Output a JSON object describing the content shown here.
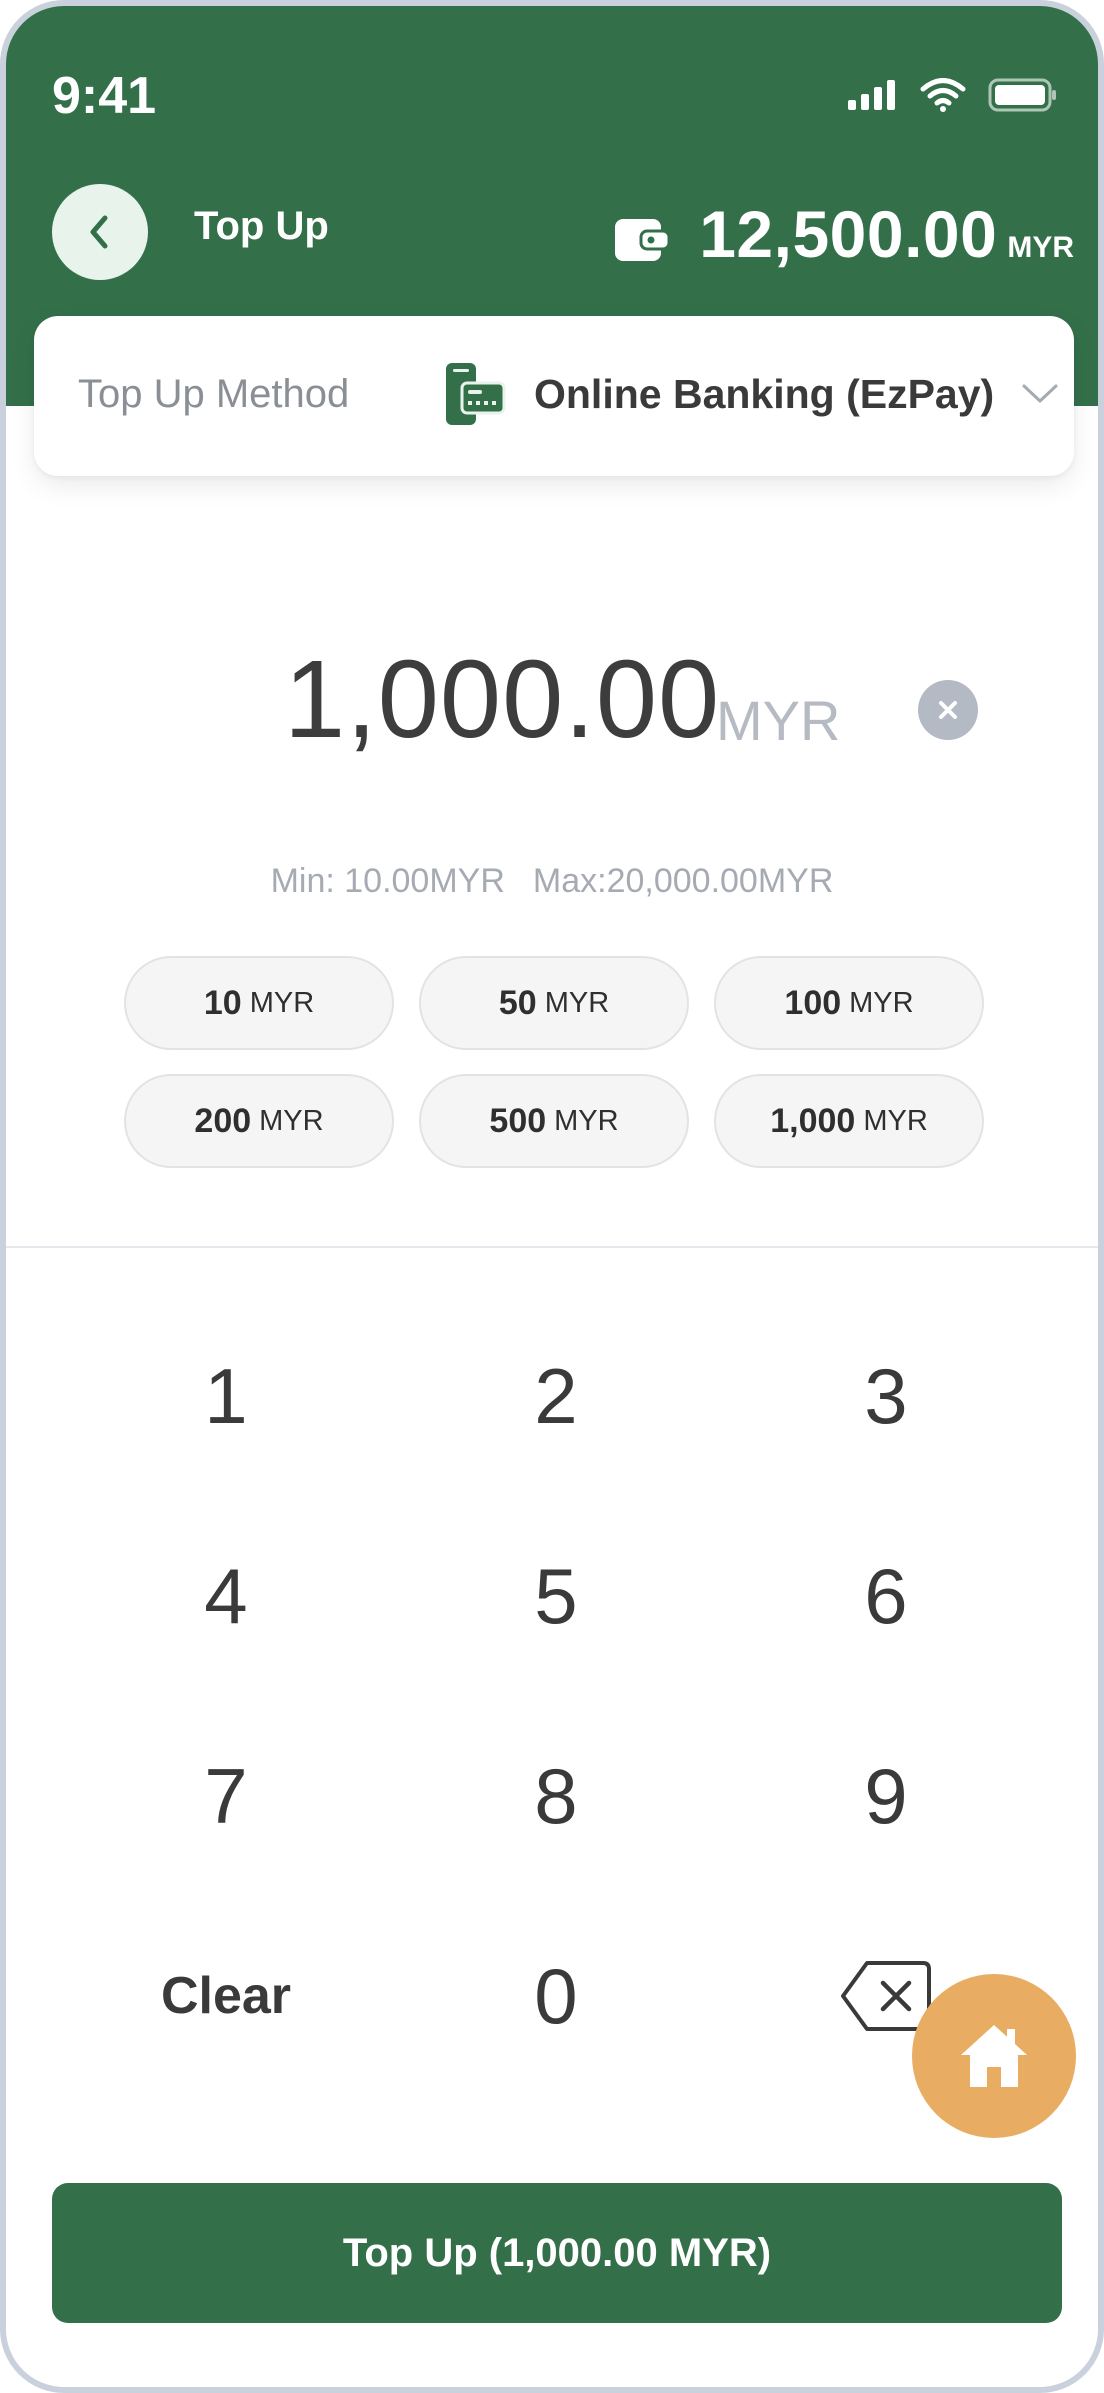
{
  "status_bar": {
    "time": "9:41"
  },
  "header": {
    "title": "Top Up",
    "balance_amount": "12,500.00",
    "balance_currency": "MYR"
  },
  "method": {
    "label": "Top Up Method",
    "value": "Online Banking (EzPay)"
  },
  "amount": {
    "value": "1,000.00",
    "currency": "MYR"
  },
  "limits": {
    "min": "Min: 10.00MYR",
    "max": "Max:20,000.00MYR"
  },
  "quick_amounts": [
    {
      "value": "10",
      "currency": "MYR"
    },
    {
      "value": "50",
      "currency": "MYR"
    },
    {
      "value": "100",
      "currency": "MYR"
    },
    {
      "value": "200",
      "currency": "MYR"
    },
    {
      "value": "500",
      "currency": "MYR"
    },
    {
      "value": "1,000",
      "currency": "MYR"
    }
  ],
  "keypad": {
    "k1": "1",
    "k2": "2",
    "k3": "3",
    "k4": "4",
    "k5": "5",
    "k6": "6",
    "k7": "7",
    "k8": "8",
    "k9": "9",
    "clear": "Clear",
    "k0": "0"
  },
  "submit_label": "Top Up (1,000.00 MYR)",
  "colors": {
    "brand": "#33704a",
    "accent": "#e8ad62"
  },
  "icons": {
    "back": "chevron-left-icon",
    "wallet": "wallet-icon",
    "method": "online-banking-icon",
    "dropdown": "chevron-down-icon",
    "clear_amount": "close-circle-icon",
    "backspace": "backspace-icon",
    "home": "home-icon"
  }
}
